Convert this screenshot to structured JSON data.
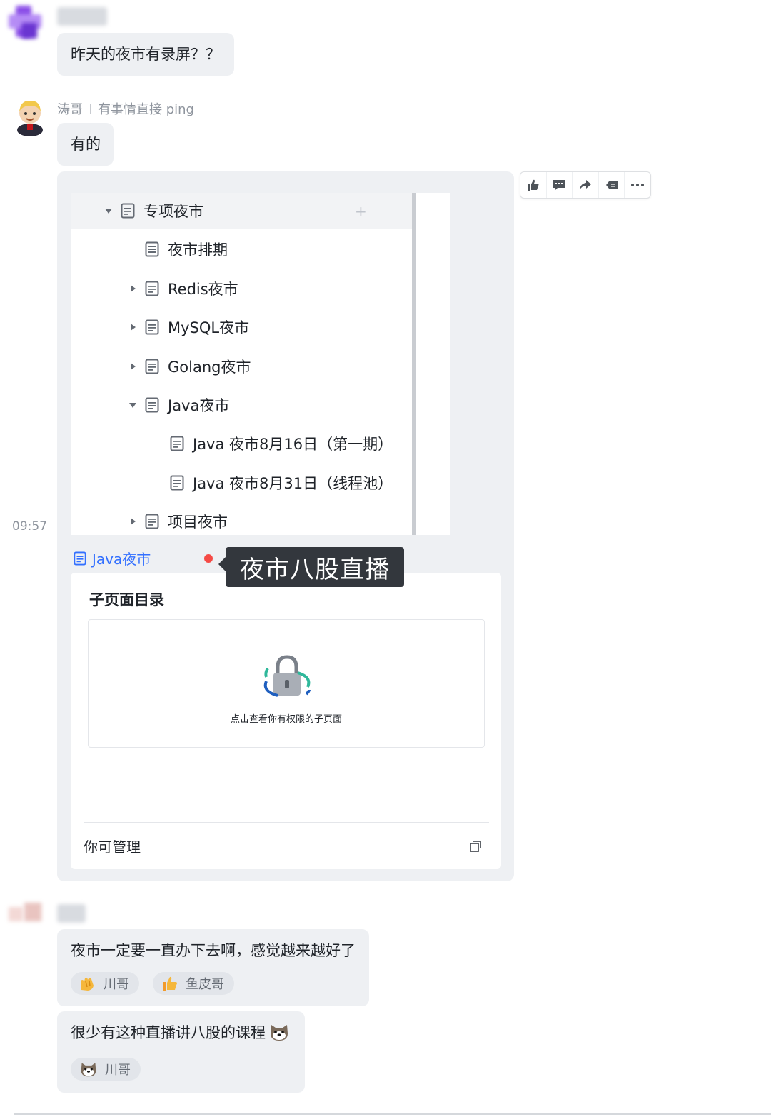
{
  "messages": {
    "m1": {
      "text": "昨天的夜市有录屏？？"
    },
    "m2": {
      "sender": "涛哥",
      "status": "有事情直接 ping",
      "text": "有的",
      "time": "09:57"
    },
    "m3": {
      "text": "夜市一定要一直办下去啊，感觉越来越好了",
      "reactions": [
        {
          "emoji": "clap-emoji",
          "user": "川哥"
        },
        {
          "emoji": "thumbs-up-emoji",
          "user": "鱼皮哥"
        }
      ]
    },
    "m4": {
      "text": "很少有这种直播讲八股的课程",
      "reactions": [
        {
          "emoji": "dog-emoji",
          "user": "川哥"
        }
      ]
    }
  },
  "toolbar": {
    "icons": [
      "thumbs-up-icon",
      "comment-icon",
      "forward-icon",
      "pin-icon",
      "more-icon"
    ]
  },
  "tree": {
    "items": [
      {
        "label": "专项夜市",
        "expanded": true,
        "level": 0
      },
      {
        "label": "夜市排期",
        "level": 1
      },
      {
        "label": "Redis夜市",
        "level": 1
      },
      {
        "label": "MySQL夜市",
        "level": 1
      },
      {
        "label": "Golang夜市",
        "level": 1
      },
      {
        "label": "Java夜市",
        "expanded": true,
        "level": 1
      },
      {
        "label": "Java 夜市8月16日（第一期）",
        "level": 2
      },
      {
        "label": "Java 夜市8月31日（线程池）",
        "level": 2
      },
      {
        "label": "项目夜市",
        "level": 1
      }
    ]
  },
  "doc_link": {
    "label": "Java夜市"
  },
  "tooltip": {
    "text": "夜市八股直播"
  },
  "preview": {
    "title": "子页面目录",
    "locked_text": "点击查看你有权限的子页面",
    "footer": "你可管理"
  },
  "colors": {
    "accent": "#3370ff",
    "bubble": "#eef0f3",
    "tooltip": "#33373d",
    "live_dot": "#f54a45"
  }
}
